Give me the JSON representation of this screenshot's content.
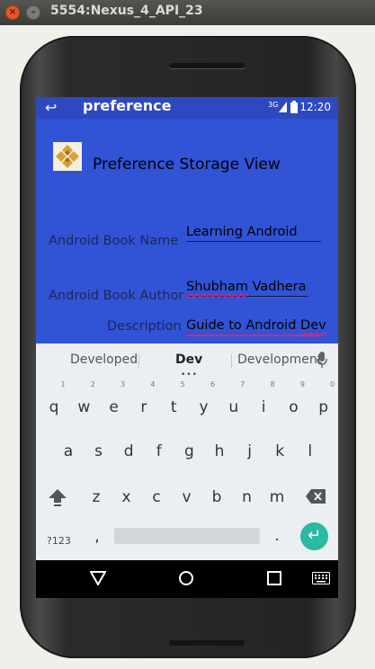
{
  "window": {
    "title": "5554:Nexus_4_API_23",
    "close_glyph": "×",
    "min_glyph": "–"
  },
  "statusbar": {
    "signal": "3G",
    "time": "12:20"
  },
  "app": {
    "back_glyph": "↩",
    "title": "preference",
    "heading": "Preference Storage View"
  },
  "form": {
    "name_label": "Android Book Name",
    "name_value": "Learning Android",
    "author_label": "Android Book Author",
    "author_value_1": "Shubham",
    "author_value_2": " Vadhera",
    "desc_label": "Description",
    "desc_value_1": "Guide to Android ",
    "desc_value_2": "Dev"
  },
  "keyboard": {
    "suggestions": [
      "Developed",
      "Dev",
      "Development"
    ],
    "row1": [
      "q",
      "w",
      "e",
      "r",
      "t",
      "y",
      "u",
      "i",
      "o",
      "p"
    ],
    "row1_hints": [
      "1",
      "2",
      "3",
      "4",
      "5",
      "6",
      "7",
      "8",
      "9",
      "0"
    ],
    "row2": [
      "a",
      "s",
      "d",
      "f",
      "g",
      "h",
      "j",
      "k",
      "l"
    ],
    "row3": [
      "z",
      "x",
      "c",
      "v",
      "b",
      "n",
      "m"
    ],
    "symbols_label": "?123",
    "comma": ",",
    "period": "."
  },
  "colors": {
    "app_bg": "#3153d6",
    "status_bg": "#2e49bf",
    "accent": "#d4267c",
    "enter": "#2bb9a4"
  },
  "icons": [
    "back-arrow-icon",
    "signal-icon",
    "sim-icon",
    "battery-icon",
    "mic-icon",
    "shift-icon",
    "backspace-icon",
    "enter-icon",
    "nav-back-icon",
    "nav-home-icon",
    "nav-recents-icon",
    "keyboard-icon"
  ]
}
